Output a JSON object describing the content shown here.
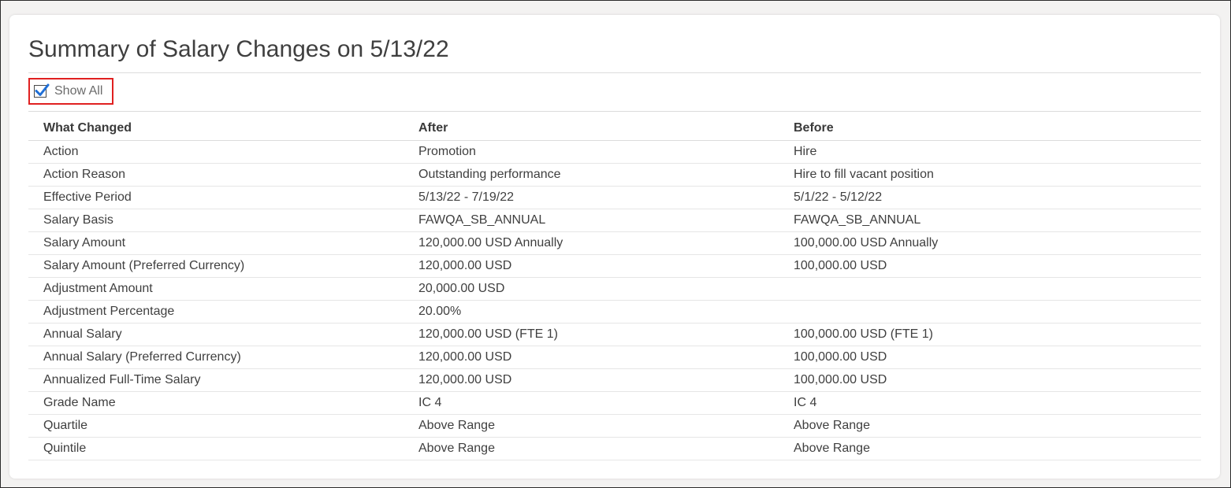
{
  "page": {
    "title": "Summary of Salary Changes on 5/13/22"
  },
  "show_all": {
    "label": "Show All",
    "checked": true,
    "highlight_color": "#e02020",
    "check_color": "#1f6fd6"
  },
  "table": {
    "columns": [
      "What Changed",
      "After",
      "Before"
    ],
    "rows": [
      [
        "Action",
        "Promotion",
        "Hire"
      ],
      [
        "Action Reason",
        "Outstanding performance",
        "Hire to fill vacant position"
      ],
      [
        "Effective Period",
        "5/13/22 - 7/19/22",
        "5/1/22 - 5/12/22"
      ],
      [
        "Salary Basis",
        "FAWQA_SB_ANNUAL",
        "FAWQA_SB_ANNUAL"
      ],
      [
        "Salary Amount",
        "120,000.00 USD Annually",
        "100,000.00 USD Annually"
      ],
      [
        "Salary Amount (Preferred Currency)",
        "120,000.00 USD",
        "100,000.00 USD"
      ],
      [
        "Adjustment Amount",
        "20,000.00 USD",
        ""
      ],
      [
        "Adjustment Percentage",
        "20.00%",
        ""
      ],
      [
        "Annual Salary",
        "120,000.00 USD (FTE 1)",
        "100,000.00 USD (FTE 1)"
      ],
      [
        "Annual Salary (Preferred Currency)",
        "120,000.00 USD",
        "100,000.00 USD"
      ],
      [
        "Annualized Full-Time Salary",
        "120,000.00 USD",
        "100,000.00 USD"
      ],
      [
        "Grade Name",
        "IC 4",
        "IC 4"
      ],
      [
        "Quartile",
        "Above Range",
        "Above Range"
      ],
      [
        "Quintile",
        "Above Range",
        "Above Range"
      ]
    ]
  }
}
